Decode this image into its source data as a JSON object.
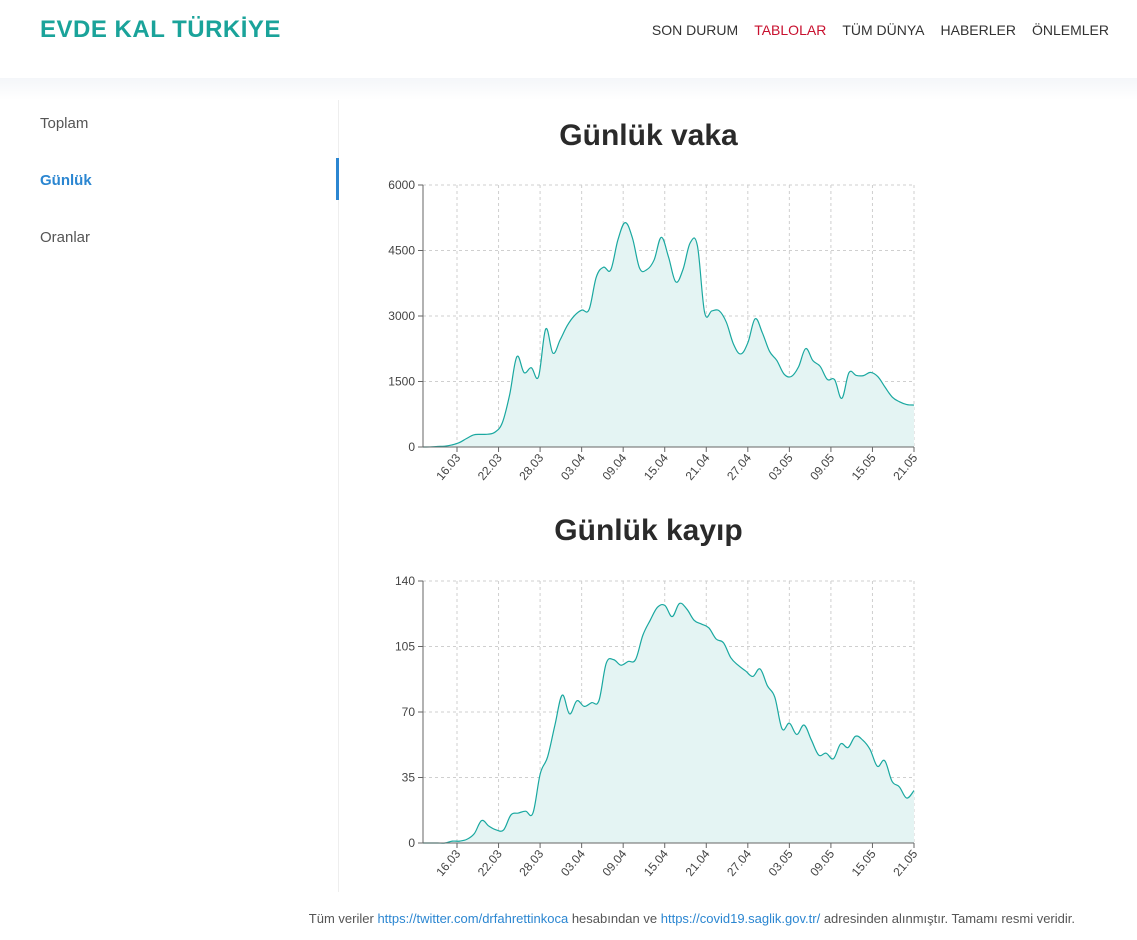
{
  "header": {
    "brand": "EVDE KAL TÜRKİYE",
    "nav": [
      {
        "label": "SON DURUM",
        "active": false
      },
      {
        "label": "TABLOLAR",
        "active": true
      },
      {
        "label": "TÜM DÜNYA",
        "active": false
      },
      {
        "label": "HABERLER",
        "active": false
      },
      {
        "label": "ÖNLEMLER",
        "active": false
      }
    ]
  },
  "sidebar": {
    "items": [
      {
        "label": "Toplam",
        "active": false
      },
      {
        "label": "Günlük",
        "active": true
      },
      {
        "label": "Oranlar",
        "active": false
      }
    ]
  },
  "colors": {
    "brand": "#1aa39a",
    "active_nav": "#c8102e",
    "link": "#2b86d1",
    "line": "#1aa8a0",
    "fill": "#e4f4f3"
  },
  "chart_data": [
    {
      "type": "area",
      "title": "Günlük vaka",
      "ylim": [
        0,
        6000
      ],
      "yticks": [
        0,
        1500,
        3000,
        4500,
        6000
      ],
      "xticks": [
        "16.03",
        "22.03",
        "28.03",
        "03.04",
        "09.04",
        "15.04",
        "21.04",
        "27.04",
        "03.05",
        "09.05",
        "15.05",
        "21.05"
      ],
      "grid": true,
      "series": [
        {
          "values": [
            0,
            1,
            12,
            18,
            47,
            98,
            191,
            277,
            289,
            293,
            343,
            561,
            1196,
            2069,
            1704,
            1815,
            1610,
            2704,
            2148,
            2456,
            2786,
            3013,
            3135,
            3148,
            3892,
            4117,
            4056,
            4747,
            5138,
            4789,
            4093,
            4062,
            4281,
            4801,
            4353,
            3783,
            4062,
            4674,
            4611,
            3083,
            3116,
            3122,
            2861,
            2357,
            2131,
            2392,
            2936,
            2615,
            2188,
            1983,
            1670,
            1614,
            1832,
            2253,
            1977,
            1848,
            1546,
            1542,
            1114,
            1704,
            1639,
            1635,
            1708,
            1610,
            1368,
            1141,
            1035,
            972,
            961
          ]
        }
      ]
    },
    {
      "type": "area",
      "title": "Günlük kayıp",
      "ylim": [
        0,
        140
      ],
      "yticks": [
        0,
        35,
        70,
        105,
        140
      ],
      "xticks": [
        "16.03",
        "22.03",
        "28.03",
        "03.04",
        "09.04",
        "15.04",
        "21.04",
        "27.04",
        "03.05",
        "09.05",
        "15.05",
        "21.05"
      ],
      "grid": true,
      "series": [
        {
          "values": [
            0,
            0,
            0,
            0,
            1,
            1,
            2,
            5,
            12,
            9,
            7,
            7,
            15,
            16,
            17,
            16,
            37,
            46,
            63,
            79,
            69,
            76,
            73,
            75,
            76,
            96,
            98,
            95,
            97,
            98,
            111,
            119,
            126,
            127,
            121,
            128,
            125,
            119,
            117,
            115,
            109,
            107,
            99,
            95,
            92,
            89,
            93,
            84,
            78,
            61,
            64,
            58,
            63,
            55,
            47,
            48,
            45,
            53,
            51,
            57,
            55,
            50,
            41,
            44,
            33,
            30,
            24,
            28
          ]
        }
      ]
    }
  ],
  "footer": {
    "prefix": "Tüm veriler",
    "link1": "https://twitter.com/drfahrettinkoca",
    "middle": "hesabından ve",
    "link2": "https://covid19.saglik.gov.tr/",
    "suffix": "adresinden alınmıştır. Tamamı resmi veridir."
  }
}
